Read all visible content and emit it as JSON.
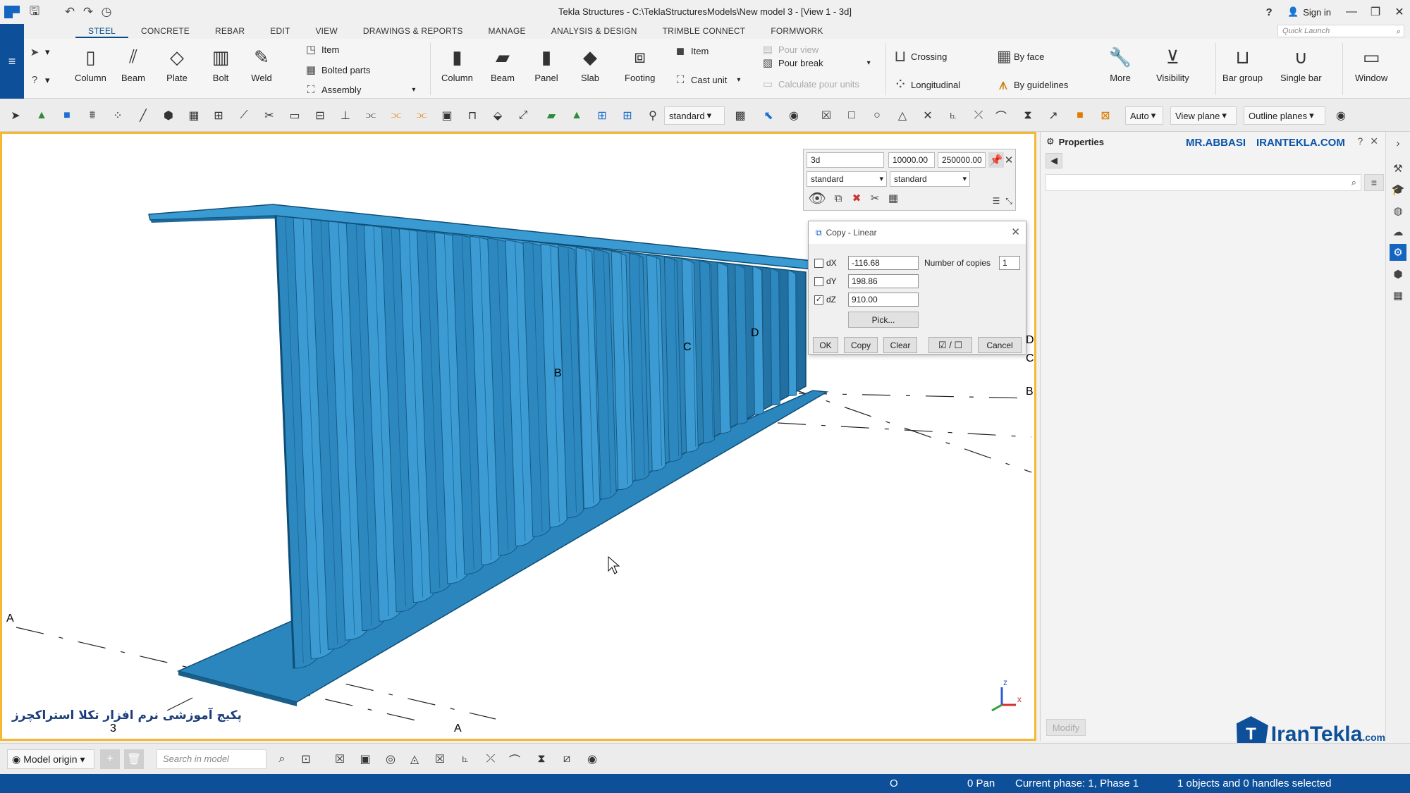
{
  "window": {
    "title": "Tekla Structures - C:\\TeklaStructuresModels\\New model 3  - [View 1 - 3d]",
    "signin": "Sign in",
    "help": "?",
    "quick_launch_placeholder": "Quick Launch"
  },
  "tabs": [
    "STEEL",
    "CONCRETE",
    "REBAR",
    "EDIT",
    "VIEW",
    "DRAWINGS & REPORTS",
    "MANAGE",
    "ANALYSIS & DESIGN",
    "TRIMBLE CONNECT",
    "FORMWORK"
  ],
  "ribbon": {
    "steel": {
      "column": "Column",
      "beam": "Beam",
      "plate": "Plate",
      "bolt": "Bolt",
      "weld": "Weld",
      "item": "Item",
      "bolted_parts": "Bolted parts",
      "assembly": "Assembly"
    },
    "concrete": {
      "column": "Column",
      "beam": "Beam",
      "panel": "Panel",
      "slab": "Slab",
      "footing": "Footing",
      "item": "Item",
      "cast_unit": "Cast unit",
      "pour_view": "Pour view",
      "pour_break": "Pour break",
      "calculate_pour_units": "Calculate pour units"
    },
    "rebar": {
      "crossing": "Crossing",
      "longitudinal": "Longitudinal",
      "by_face": "By face",
      "by_guidelines": "By guidelines",
      "more": "More",
      "visibility": "Visibility",
      "bar_group": "Bar group",
      "single_bar": "Single bar",
      "window": "Window"
    }
  },
  "toolbar2": {
    "standard": "standard",
    "auto": "Auto",
    "view_plane": "View plane",
    "outline_planes": "Outline planes"
  },
  "display_panel": {
    "view_name": "3d",
    "depth_up": "10000.00",
    "depth_down": "250000.00",
    "filter1": "standard",
    "filter2": "standard"
  },
  "copy_dialog": {
    "title": "Copy - Linear",
    "dx_label": "dX",
    "dx_value": "-116.68",
    "dy_label": "dY",
    "dy_value": "198.86",
    "dz_label": "dZ",
    "dz_value": "910.00",
    "copies_label": "Number of copies",
    "copies_value": "1",
    "pick": "Pick...",
    "ok": "OK",
    "copy": "Copy",
    "clear": "Clear",
    "cancel": "Cancel",
    "dx_checked": false,
    "dy_checked": false,
    "dz_checked": true
  },
  "viewport": {
    "grid_labels": {
      "a_left": "A",
      "a_bottom": "A",
      "b_mid": "B",
      "c_mid": "C",
      "d_mid": "D",
      "b_right": "B",
      "c_right": "C",
      "d_right": "D",
      "three": "3"
    },
    "watermark": "پکیج آموزشی نرم افزار تکلا استراکچرز",
    "axis_z": "z",
    "axis_x": "x",
    "beam_color": "#2f8fc4",
    "highlight_color": "#f5b82e"
  },
  "properties": {
    "title": "Properties",
    "brand1": "MR.ABBASI",
    "brand2": "IRANTEKLA.COM",
    "modify": "Modify"
  },
  "logo": {
    "name": "IranTekla",
    "suffix": ".com"
  },
  "bottombar": {
    "model_origin": "Model origin",
    "search_placeholder": "Search in model"
  },
  "status": {
    "o": "O",
    "pan": "0 Pan",
    "phase": "Current phase: 1, Phase 1",
    "selection": "1 objects and 0 handles selected"
  }
}
